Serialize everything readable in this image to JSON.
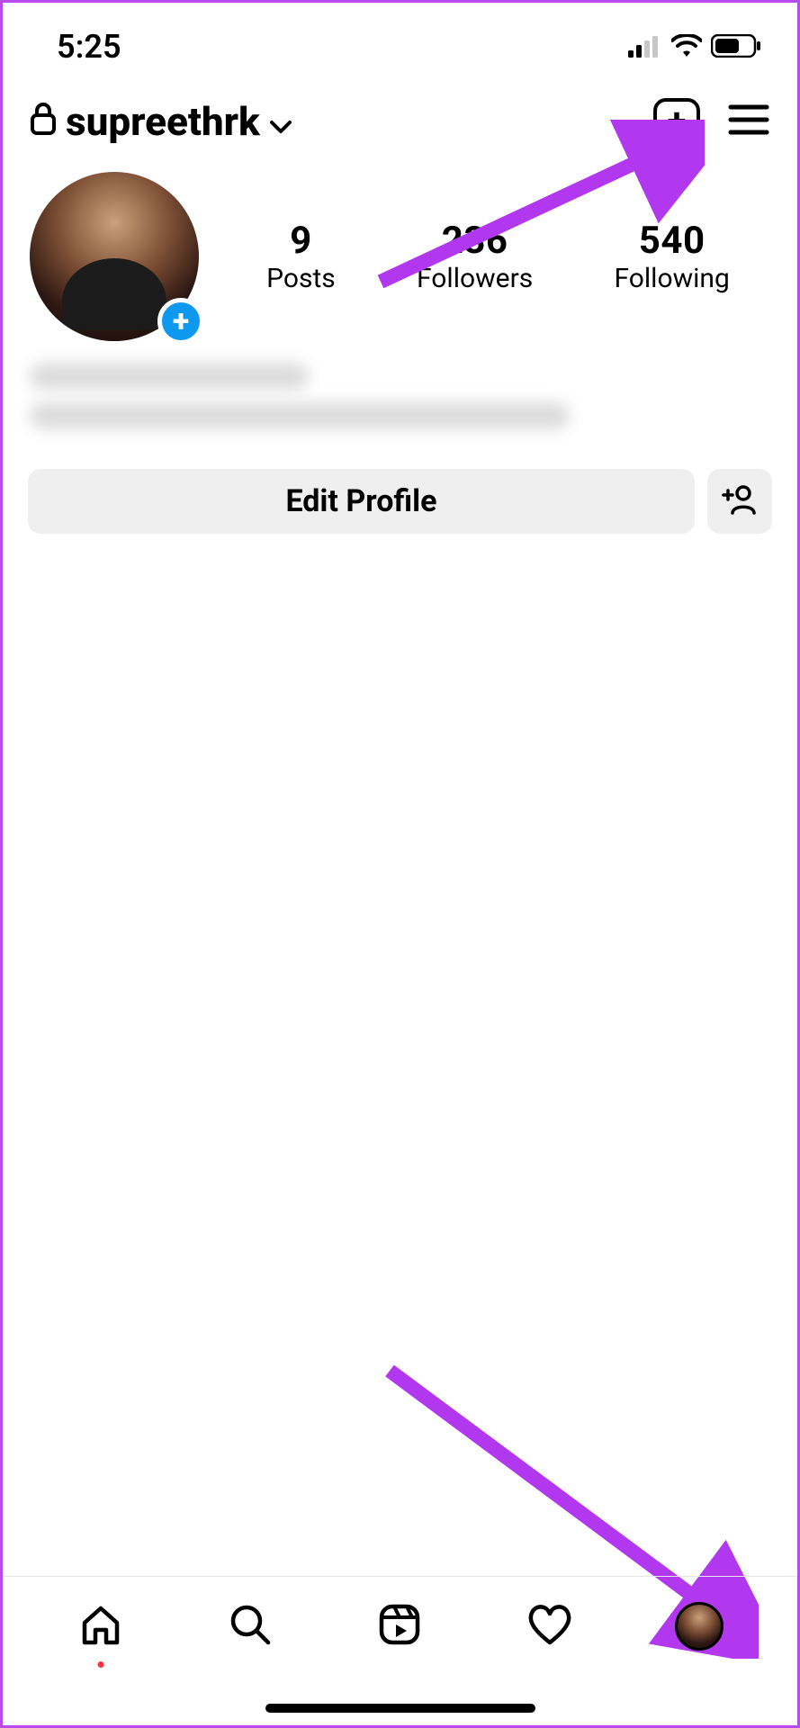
{
  "status": {
    "time": "5:25"
  },
  "header": {
    "username": "supreethrk"
  },
  "stats": {
    "posts": {
      "count": "9",
      "label": "Posts"
    },
    "followers": {
      "count": "236",
      "label": "Followers"
    },
    "following": {
      "count": "540",
      "label": "Following"
    }
  },
  "actions": {
    "edit_profile": "Edit Profile"
  },
  "colors": {
    "accent_arrow": "#b238ef",
    "avatar_plus": "#0f98f0"
  }
}
